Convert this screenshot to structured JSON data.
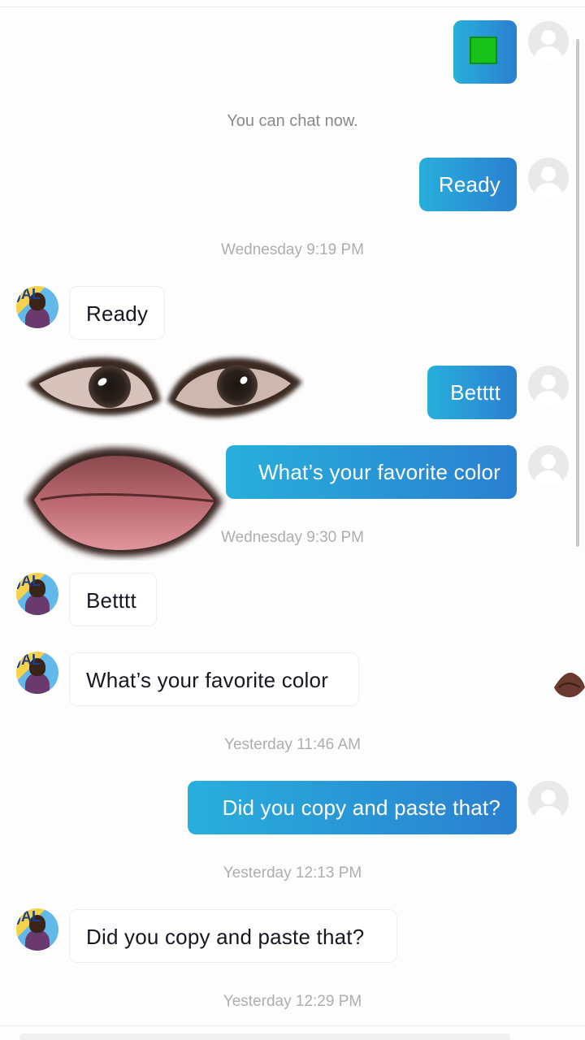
{
  "conversation": {
    "system_notice": "You can chat now.",
    "timestamps": {
      "t1": "Wednesday 9:19 PM",
      "t2": "Wednesday 9:30 PM",
      "t3": "Yesterday 11:46 AM",
      "t4": "Yesterday 12:13 PM",
      "t5": "Yesterday 12:29 PM"
    },
    "messages": {
      "m1": {
        "sender": "me",
        "text": "Ready"
      },
      "m2": {
        "sender": "other",
        "text": "Ready"
      },
      "m3": {
        "sender": "me",
        "text": "Betttt"
      },
      "m4": {
        "sender": "me",
        "text": "What’s your favorite color"
      },
      "m5": {
        "sender": "other",
        "text": "Betttt"
      },
      "m6": {
        "sender": "other",
        "text": "What’s your favorite color"
      },
      "m7": {
        "sender": "me",
        "text": "Did you copy and paste that?"
      },
      "m8": {
        "sender": "other",
        "text": "Did you copy and paste that?"
      }
    }
  },
  "colors": {
    "outgoing_bubble_start": "#28afdc",
    "outgoing_bubble_end": "#2a7fd0",
    "incoming_bubble": "#ffffff",
    "timestamp_text": "#aeaeae",
    "sticker_green": "#19c219"
  },
  "icons": {
    "my_avatar": "default-user-avatar-icon",
    "other_avatar": "user-photo-avatar",
    "sticker": "green-square-emoji-icon",
    "overlay_eyes": "eyes-sticker-overlay",
    "overlay_lips": "lips-sticker-overlay"
  }
}
